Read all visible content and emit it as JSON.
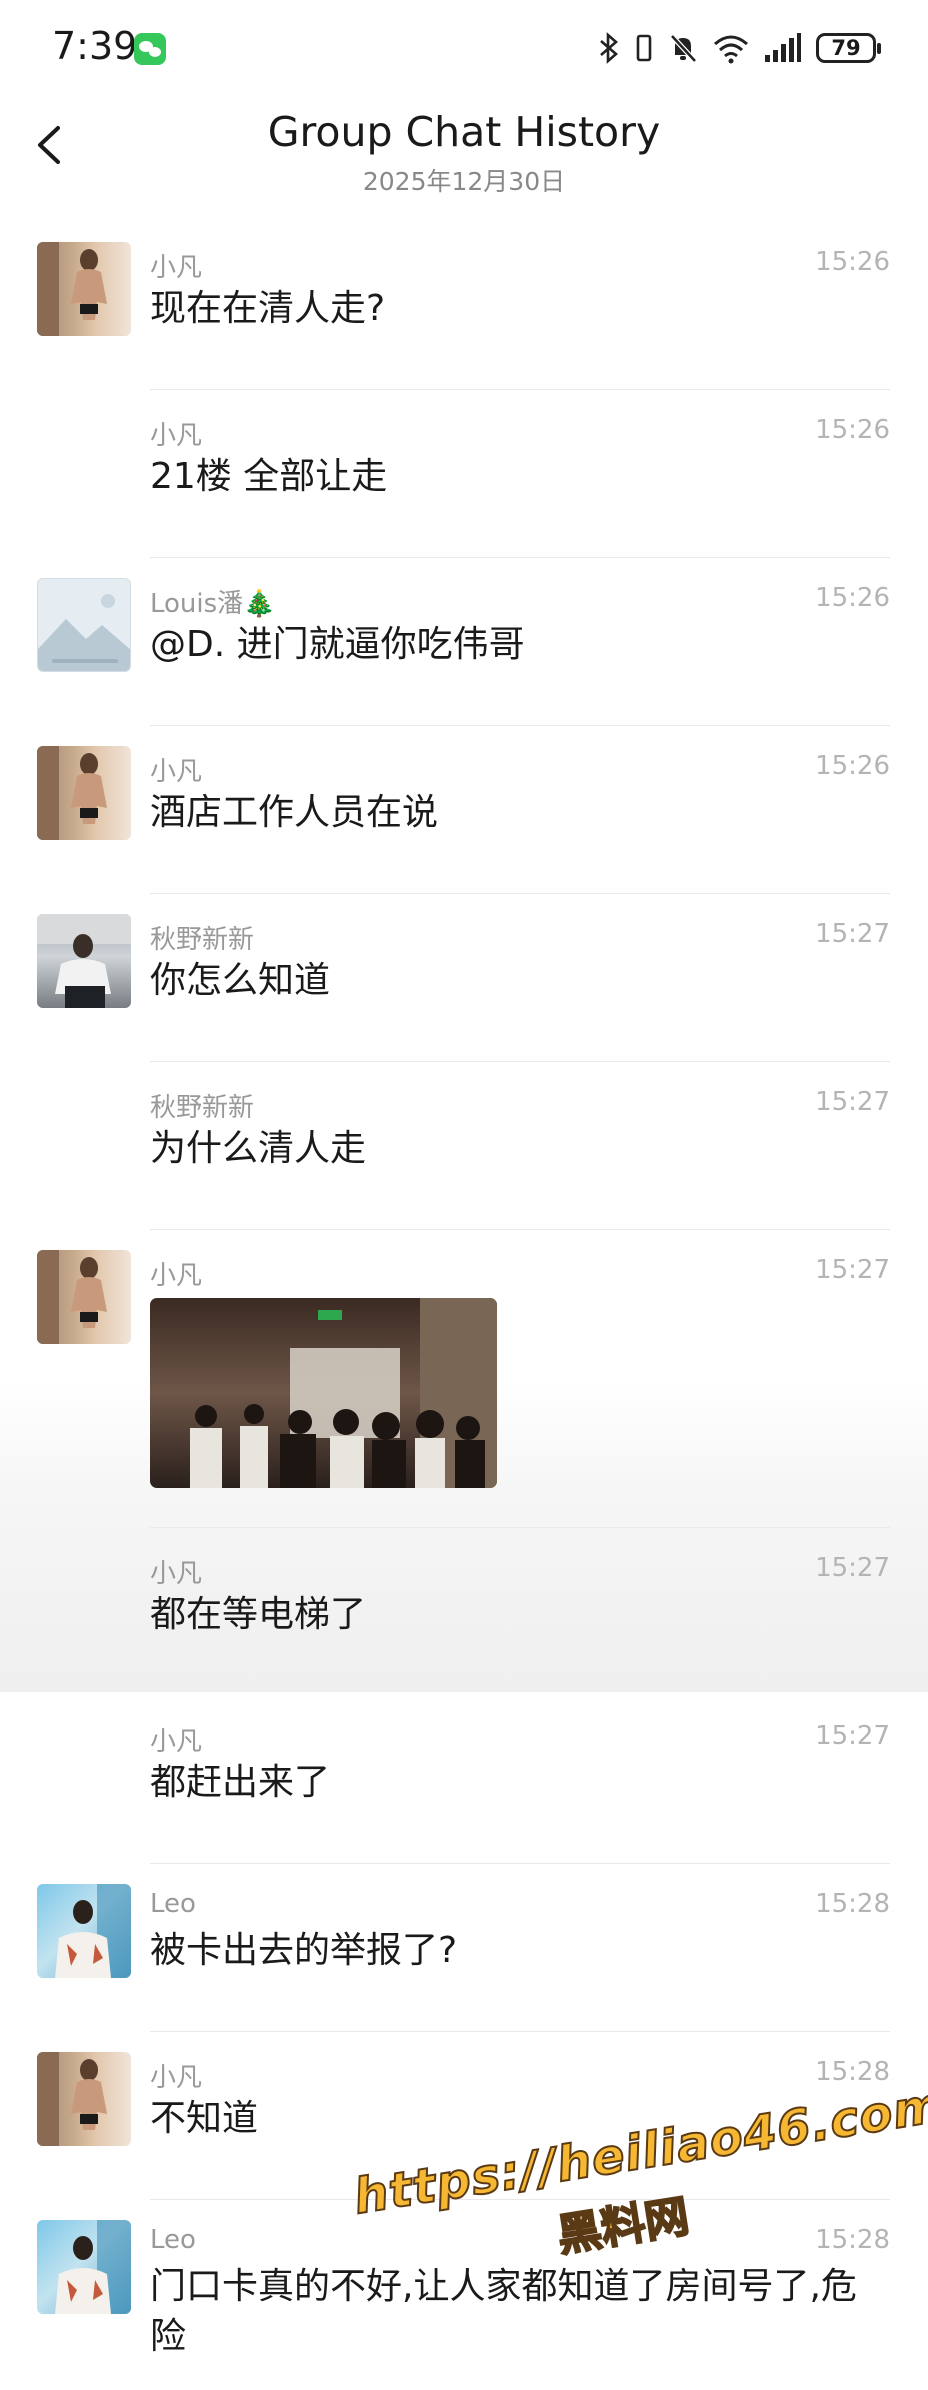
{
  "status_bar": {
    "time": "7:39",
    "battery": "79"
  },
  "header": {
    "title": "Group Chat History",
    "date": "2025年12月30日"
  },
  "messages": [
    {
      "sender": "小凡",
      "time": "15:26",
      "text": "现在在清人走?",
      "avatar": "man"
    },
    {
      "sender": "小凡",
      "time": "15:26",
      "text": "21楼 全部让走",
      "avatar": "none"
    },
    {
      "sender": "Louis潘🎄",
      "time": "15:26",
      "text": "@D. 进门就逼你吃伟哥",
      "avatar": "landscape"
    },
    {
      "sender": "小凡",
      "time": "15:26",
      "text": "酒店工作人员在说",
      "avatar": "man"
    },
    {
      "sender": "秋野新新",
      "time": "15:27",
      "text": "你怎么知道",
      "avatar": "gym"
    },
    {
      "sender": "秋野新新",
      "time": "15:27",
      "text": "为什么清人走",
      "avatar": "none"
    },
    {
      "sender": "小凡",
      "time": "15:27",
      "text": "",
      "avatar": "man",
      "image": "photo of people waiting in hallway"
    },
    {
      "sender": "小凡",
      "time": "15:27",
      "text": "都在等电梯了",
      "avatar": "none"
    },
    {
      "sender": "小凡",
      "time": "15:27",
      "text": "都赶出来了",
      "avatar": "none"
    },
    {
      "sender": "Leo",
      "time": "15:28",
      "text": "被卡出去的举报了?",
      "avatar": "leo"
    },
    {
      "sender": "小凡",
      "time": "15:28",
      "text": "不知道",
      "avatar": "man"
    },
    {
      "sender": "Leo",
      "time": "15:28",
      "text": "门口卡真的不好,让人家都知道了房间号了,危险",
      "avatar": "leo"
    }
  ],
  "watermark": {
    "url": "https://heiliao46.com",
    "name": "黑料网"
  },
  "icons": {
    "back": "chevron-left-icon",
    "bluetooth": "bluetooth-icon",
    "mute": "bell-off-icon",
    "wifi": "wifi-icon",
    "signal": "signal-icon"
  }
}
